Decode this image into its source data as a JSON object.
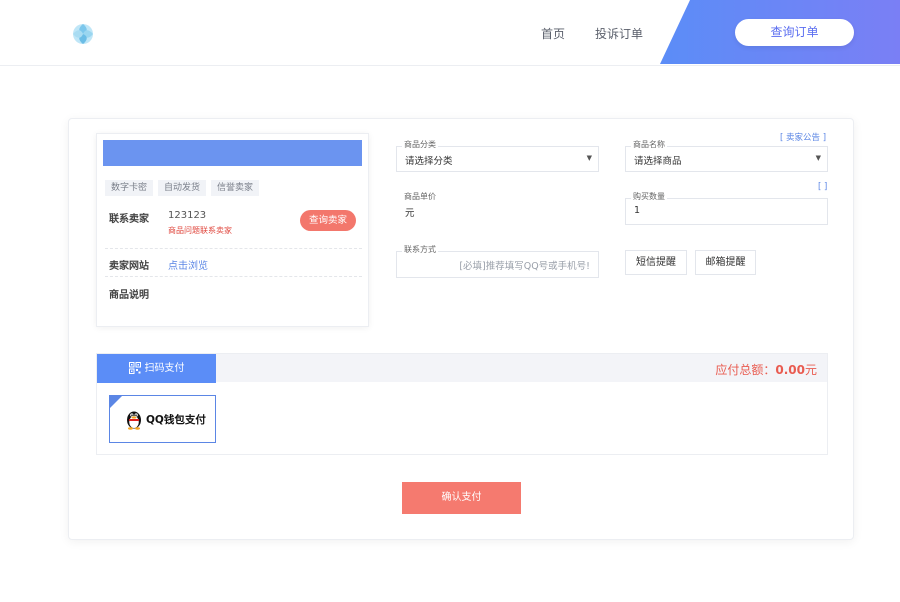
{
  "header": {
    "nav": {
      "home": "首页",
      "complaint": "投诉订单"
    },
    "query_order_button": "查询订单",
    "accent_gradient": [
      "#5b8df7",
      "#7a7ff5"
    ]
  },
  "seller": {
    "tags": [
      "数字卡密",
      "自动发货",
      "信誉卖家"
    ],
    "contact": {
      "label": "联系卖家",
      "value": "123123",
      "hint": "商品问题联系卖家"
    },
    "query_seller_button": "查询卖家",
    "website": {
      "label": "卖家网站",
      "link": "点击浏览"
    },
    "description_label": "商品说明"
  },
  "form": {
    "category": {
      "label": "商品分类",
      "value": "请选择分类"
    },
    "product": {
      "label": "商品名称",
      "value": "请选择商品"
    },
    "unit_price": {
      "label": "商品单价",
      "value": "元"
    },
    "quantity": {
      "label": "购买数量",
      "value": "1"
    },
    "contact": {
      "label": "联系方式",
      "placeholder": "[必填]推荐填写QQ号或手机号!"
    },
    "seller_notice": "[ 卖家公告 ]",
    "bracket_link": "[ ]",
    "sms_button": "短信提醒",
    "email_button": "邮箱提醒"
  },
  "payment": {
    "scan_tab": "扫码支付",
    "total_label": "应付总额：",
    "total_amount": "0.00",
    "total_unit": "元",
    "methods": [
      {
        "name": "QQ钱包支付",
        "icon": "qq-penguin-icon",
        "selected": true
      }
    ]
  },
  "confirm_button": "确认支付",
  "colors": {
    "primary_blue": "#5b8df7",
    "accent_red": "#f57a6f",
    "hint_red": "#e0483f",
    "link_blue": "#5b86e5"
  }
}
